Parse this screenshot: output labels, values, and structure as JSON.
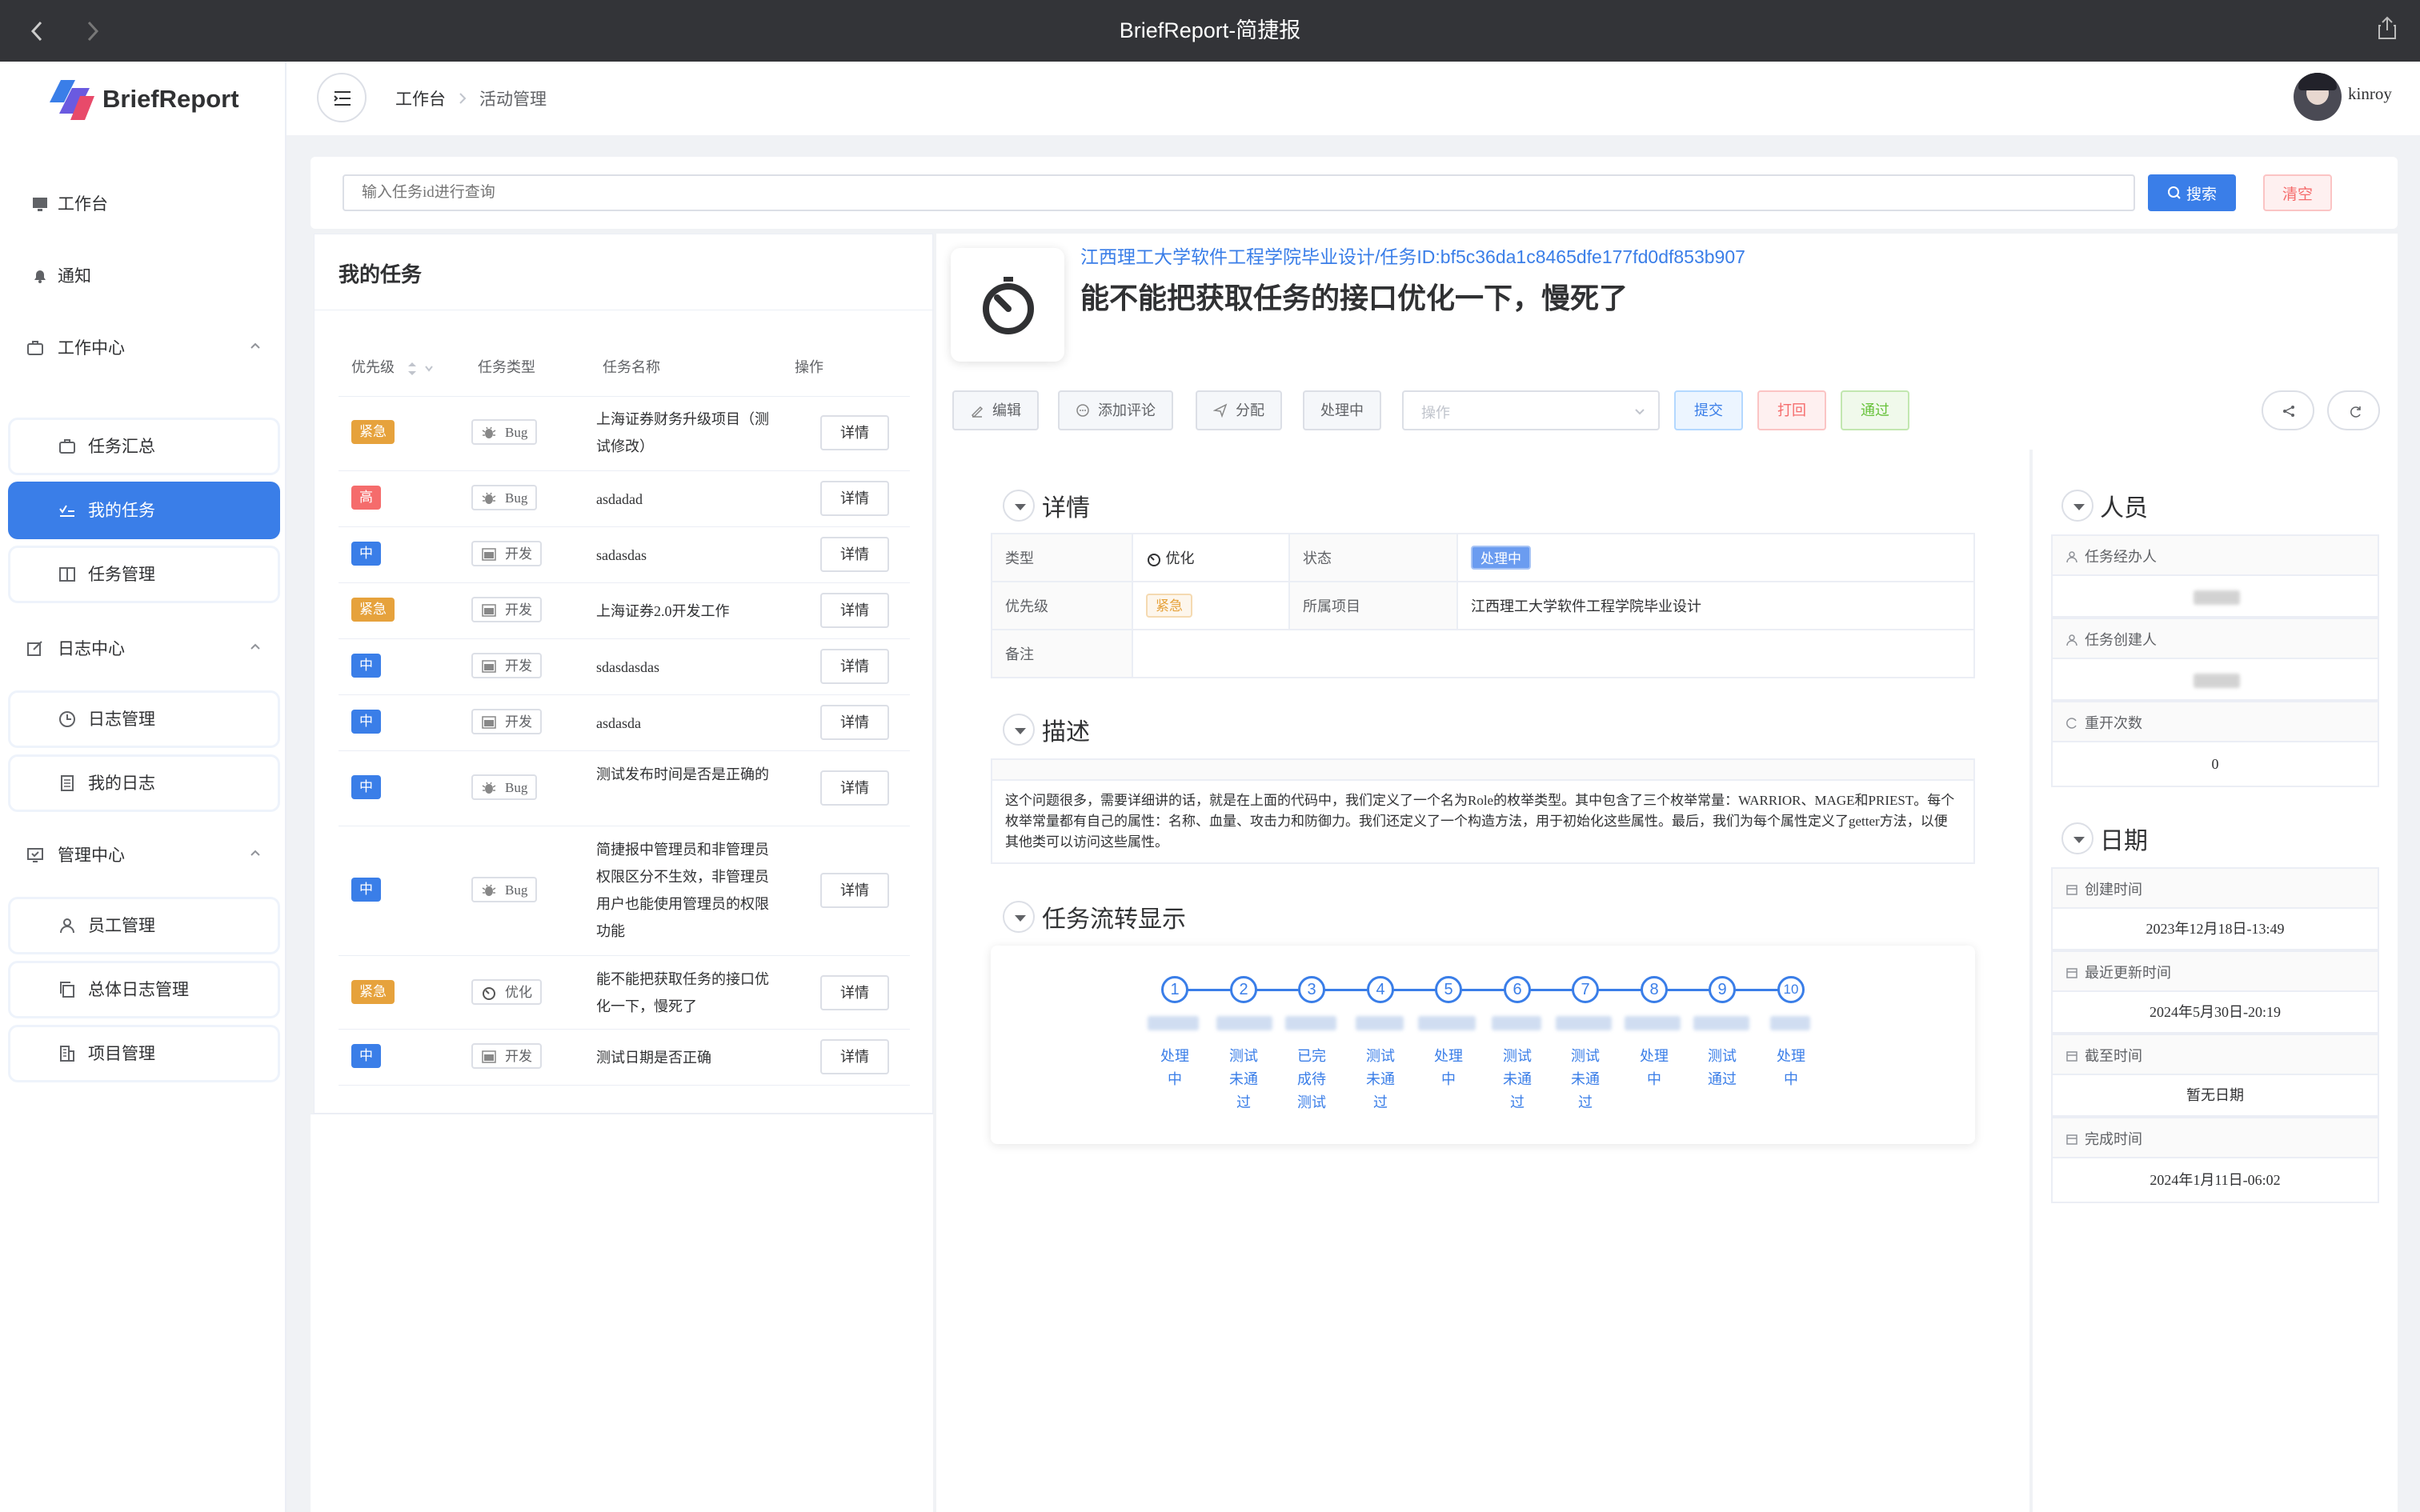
{
  "window": {
    "title": "BriefReport-简捷报"
  },
  "brand": {
    "name": "BriefReport"
  },
  "sidebar": {
    "items": [
      {
        "label": "工作台",
        "icon": "monitor-icon"
      },
      {
        "label": "通知",
        "icon": "bell-icon"
      },
      {
        "label": "工作中心",
        "icon": "briefcase-icon"
      },
      {
        "label": "任务汇总",
        "icon": "briefcase-icon"
      },
      {
        "label": "我的任务",
        "icon": "checklist-icon"
      },
      {
        "label": "任务管理",
        "icon": "book-icon"
      },
      {
        "label": "日志中心",
        "icon": "edit-icon"
      },
      {
        "label": "日志管理",
        "icon": "clock-icon"
      },
      {
        "label": "我的日志",
        "icon": "document-icon"
      },
      {
        "label": "管理中心",
        "icon": "monitor-check-icon"
      },
      {
        "label": "员工管理",
        "icon": "user-icon"
      },
      {
        "label": "总体日志管理",
        "icon": "copy-icon"
      },
      {
        "label": "项目管理",
        "icon": "building-icon"
      }
    ]
  },
  "header": {
    "breadcrumb": [
      "工作台",
      "活动管理"
    ],
    "user": "kinroy"
  },
  "search": {
    "placeholder": "输入任务id进行查询",
    "search_label": "搜索",
    "clear_label": "清空"
  },
  "tasks": {
    "title": "我的任务",
    "columns": [
      "优先级",
      "任务类型",
      "任务名称",
      "操作"
    ],
    "detail_label": "详情",
    "rows": [
      {
        "priority": "紧急",
        "type": "Bug",
        "name": "上海证券财务升级项目（测试修改）"
      },
      {
        "priority": "高",
        "type": "Bug",
        "name": "asdadad"
      },
      {
        "priority": "中",
        "type": "开发",
        "name": "sadasdas"
      },
      {
        "priority": "紧急",
        "type": "开发",
        "name": "上海证券2.0开发工作"
      },
      {
        "priority": "中",
        "type": "开发",
        "name": "sdasdasdas"
      },
      {
        "priority": "中",
        "type": "开发",
        "name": "asdasda"
      },
      {
        "priority": "中",
        "type": "Bug",
        "name": "测试发布时间是否是正确的"
      },
      {
        "priority": "中",
        "type": "Bug",
        "name": "简捷报中管理员和非管理员权限区分不生效，非管理员用户也能使用管理员的权限功能"
      },
      {
        "priority": "紧急",
        "type": "优化",
        "name": "能不能把获取任务的接口优化一下，慢死了"
      },
      {
        "priority": "中",
        "type": "开发",
        "name": "测试日期是否正确"
      }
    ]
  },
  "detail": {
    "path": "江西理工大学软件工程学院毕业设计/任务ID:bf5c36da1c8465dfe177fd0df853b907",
    "title": "能不能把获取任务的接口优化一下，慢死了",
    "actions": {
      "edit": "编辑",
      "comment": "添加评论",
      "assign": "分配",
      "status": "处理中",
      "operation_placeholder": "操作",
      "submit": "提交",
      "reject": "打回",
      "pass": "通过"
    },
    "sections": {
      "details": "详情",
      "description": "描述",
      "flow": "任务流转显示",
      "people": "人员",
      "dates": "日期"
    },
    "fields": {
      "type_k": "类型",
      "type_v": "优化",
      "status_k": "状态",
      "status_v": "处理中",
      "priority_k": "优先级",
      "priority_v": "紧急",
      "project_k": "所属项目",
      "project_v": "江西理工大学软件工程学院毕业设计",
      "remark_k": "备注",
      "remark_v": ""
    },
    "description": "这个问题很多，需要详细讲的话，就是在上面的代码中，我们定义了一个名为Role的枚举类型。其中包含了三个枚举常量：WARRIOR、MAGE和PRIEST。每个枚举常量都有自己的属性：名称、血量、攻击力和防御力。我们还定义了一个构造方法，用于初始化这些属性。最后，我们为每个属性定义了getter方法，以便其他类可以访问这些属性。",
    "flow": [
      {
        "n": "1",
        "label": "处理中"
      },
      {
        "n": "2",
        "label": "测试未通过"
      },
      {
        "n": "3",
        "label": "已完成待测试"
      },
      {
        "n": "4",
        "label": "测试未通过"
      },
      {
        "n": "5",
        "label": "处理中"
      },
      {
        "n": "6",
        "label": "测试未通过"
      },
      {
        "n": "7",
        "label": "测试未通过"
      },
      {
        "n": "8",
        "label": "处理中"
      },
      {
        "n": "9",
        "label": "测试通过"
      },
      {
        "n": "10",
        "label": "处理中"
      }
    ],
    "people": {
      "assignee_k": "任务经办人",
      "creator_k": "任务创建人",
      "reopen_k": "重开次数",
      "reopen_v": "0"
    },
    "dates": {
      "created_k": "创建时间",
      "created_v": "2023年12月18日-13:49",
      "updated_k": "最近更新时间",
      "updated_v": "2024年5月30日-20:19",
      "deadline_k": "截至时间",
      "deadline_v": "暂无日期",
      "finished_k": "完成时间",
      "finished_v": "2024年1月11日-06:02"
    }
  },
  "colors": {
    "accent": "#3a7ee8",
    "urgent": "#e6a23c",
    "high": "#f56c6c",
    "medium": "#3a7ee8"
  }
}
